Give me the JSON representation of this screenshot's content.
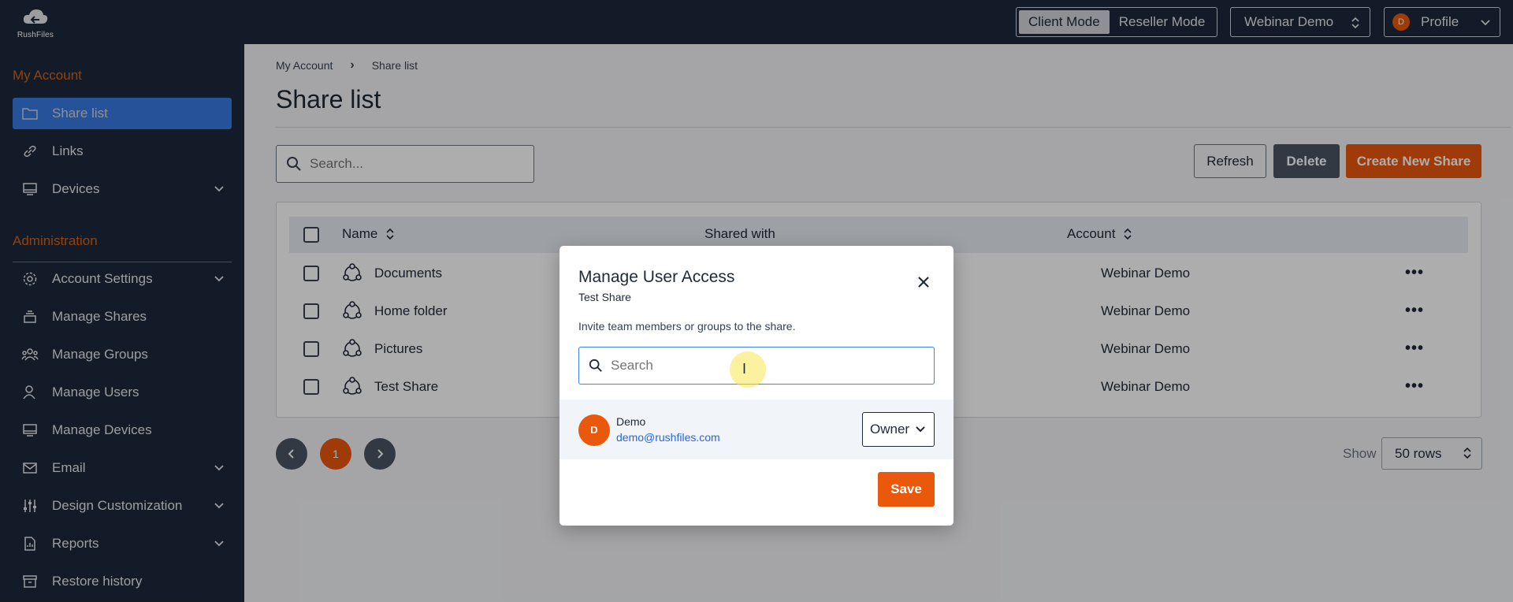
{
  "brand": {
    "logo_text": "RushFiles"
  },
  "topbar": {
    "modes": [
      {
        "label": "Client Mode",
        "active": true
      },
      {
        "label": "Reseller Mode",
        "active": false
      }
    ],
    "account_select": "Webinar Demo",
    "profile": {
      "avatar_initial": "D",
      "label": "Profile"
    }
  },
  "sidebar": {
    "section_my_account": "My Account",
    "section_admin": "Administration",
    "items": [
      {
        "label": "Share list",
        "icon": "folder-icon",
        "active": true
      },
      {
        "label": "Links",
        "icon": "link-icon"
      },
      {
        "label": "Devices",
        "icon": "monitor-icon",
        "expandable": true
      },
      {
        "label": "Account Settings",
        "icon": "gear-icon",
        "expandable": true
      },
      {
        "label": "Manage Shares",
        "icon": "stack-icon"
      },
      {
        "label": "Manage Groups",
        "icon": "group-icon"
      },
      {
        "label": "Manage Users",
        "icon": "users-icon"
      },
      {
        "label": "Manage Devices",
        "icon": "monitor-icon"
      },
      {
        "label": "Email",
        "icon": "mail-icon",
        "expandable": true
      },
      {
        "label": "Design Customization",
        "icon": "sliders-icon",
        "expandable": true
      },
      {
        "label": "Reports",
        "icon": "report-icon",
        "expandable": true
      },
      {
        "label": "Restore history",
        "icon": "archive-icon"
      }
    ]
  },
  "main": {
    "breadcrumb": [
      "My Account",
      "Share list"
    ],
    "title": "Share list",
    "search_placeholder": "Search...",
    "buttons": {
      "refresh": "Refresh",
      "delete": "Delete",
      "create": "Create New Share"
    },
    "table": {
      "columns": [
        "Name",
        "Shared with",
        "Account"
      ],
      "rows": [
        {
          "name": "Documents",
          "account": "Webinar Demo"
        },
        {
          "name": "Home folder",
          "account": "Webinar Demo"
        },
        {
          "name": "Pictures",
          "account": "Webinar Demo"
        },
        {
          "name": "Test Share",
          "account": "Webinar Demo"
        }
      ]
    },
    "pagination": {
      "current_page": "1"
    },
    "show_label": "Show",
    "rows_per_page": "50 rows"
  },
  "modal": {
    "title": "Manage User Access",
    "subtitle": "Test Share",
    "description": "Invite team members or groups to the share.",
    "search_placeholder": "Search",
    "members": [
      {
        "initial": "D",
        "name": "Demo",
        "email": "demo@rushfiles.com",
        "role": "Owner"
      }
    ],
    "save_label": "Save"
  },
  "colors": {
    "accent": "#ea580c",
    "nav_bg": "#1e293b",
    "active_item": "#3b82f6"
  }
}
